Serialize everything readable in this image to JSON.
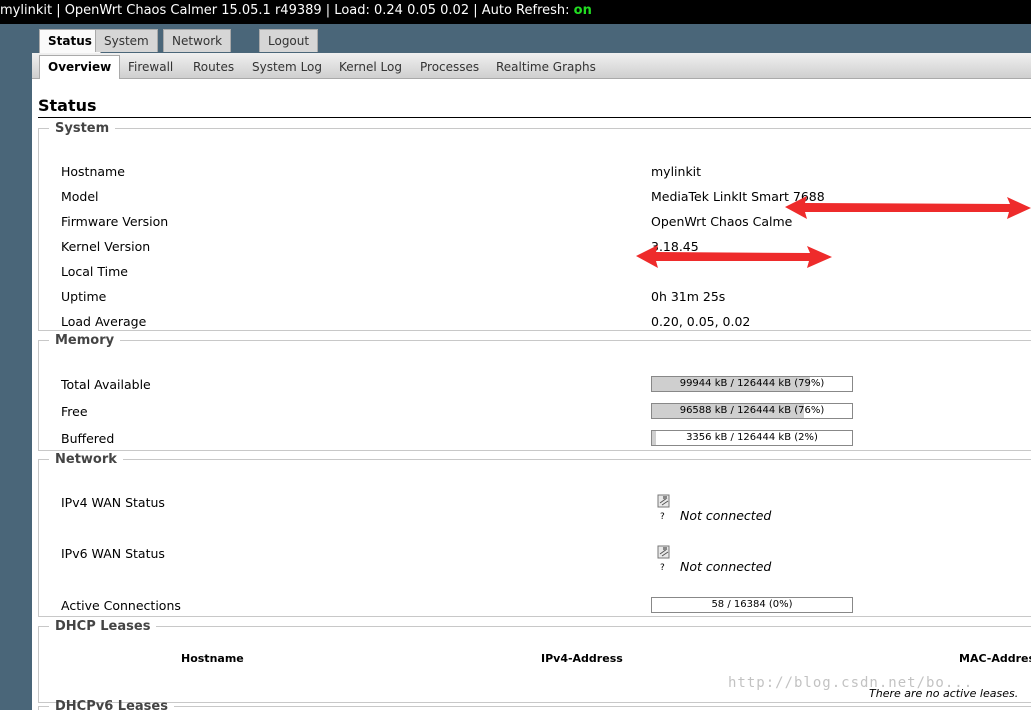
{
  "topbar": {
    "text": "mylinkit | OpenWrt Chaos Calmer 15.05.1 r49389 | Load: 0.24 0.05 0.02 | Auto Refresh: ",
    "auto_refresh": "on"
  },
  "main_tabs": [
    "Status",
    "System",
    "Network",
    "Logout"
  ],
  "sub_tabs": [
    "Overview",
    "Firewall",
    "Routes",
    "System Log",
    "Kernel Log",
    "Processes",
    "Realtime Graphs"
  ],
  "page_title": "Status",
  "system": {
    "legend": "System",
    "rows": [
      {
        "label": "Hostname",
        "value": "mylinkit"
      },
      {
        "label": "Model",
        "value": "MediaTek LinkIt Smart 7688"
      },
      {
        "label": "Firmware Version",
        "value": "OpenWrt Chaos Calme"
      },
      {
        "label": "Kernel Version",
        "value": "3.18.45"
      },
      {
        "label": "Local Time",
        "value": ""
      },
      {
        "label": "Uptime",
        "value": "0h 31m 25s"
      },
      {
        "label": "Load Average",
        "value": "0.20, 0.05, 0.02"
      }
    ]
  },
  "memory": {
    "legend": "Memory",
    "rows": [
      {
        "label": "Total Available",
        "text": "99944 kB / 126444 kB (79%)",
        "fraction": 0.79
      },
      {
        "label": "Free",
        "text": "96588 kB / 126444 kB (76%)",
        "fraction": 0.76
      },
      {
        "label": "Buffered",
        "text": "3356 kB / 126444 kB (2%)",
        "fraction": 0.02
      }
    ]
  },
  "network": {
    "legend": "Network",
    "ipv4_label": "IPv4 WAN Status",
    "ipv4_status": "Not connected",
    "ipv6_label": "IPv6 WAN Status",
    "ipv6_status": "Not connected",
    "icon_question": "?",
    "conn_label": "Active Connections",
    "conn_text": "58 / 16384 (0%)",
    "conn_fraction": 0.0
  },
  "dhcp": {
    "legend": "DHCP Leases",
    "headers": [
      "Hostname",
      "IPv4-Address",
      "MAC-Address"
    ],
    "empty": "There are no active leases."
  },
  "dhcpv6": {
    "legend": "DHCPv6 Leases"
  },
  "watermark": "http://blog.csdn.net/bo..."
}
